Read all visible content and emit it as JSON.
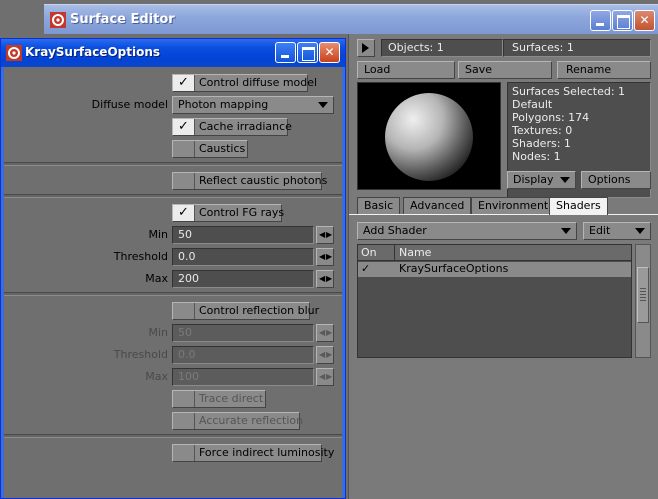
{
  "surface_editor": {
    "title": "Surface Editor",
    "objects_label": "Objects: 1",
    "surfaces_label": "Surfaces: 1",
    "load_label": "Load",
    "save_label": "Save",
    "rename_label": "Rename",
    "info": {
      "surfaces_selected": "Surfaces Selected: 1",
      "default": "Default",
      "polygons": "Polygons: 174",
      "textures": "Textures: 0",
      "shaders": "Shaders: 1",
      "nodes": "Nodes: 1"
    },
    "display_label": "Display",
    "options_label": "Options",
    "tabs": [
      "Basic",
      "Advanced",
      "Environment",
      "Shaders"
    ],
    "active_tab": "Shaders",
    "add_shader_label": "Add Shader",
    "edit_label": "Edit",
    "list_headers": {
      "on": "On",
      "name": "Name"
    },
    "shader_rows": [
      {
        "on": "✓",
        "name": "KraySurfaceOptions"
      }
    ]
  },
  "kray": {
    "title": "KraySurfaceOptions",
    "control_diffuse_model": {
      "label": "Control diffuse model",
      "checked": true
    },
    "diffuse_model_label": "Diffuse model",
    "diffuse_model_value": "Photon mapping",
    "cache_irradiance": {
      "label": "Cache irradiance",
      "checked": true
    },
    "caustics": {
      "label": "Caustics",
      "checked": false
    },
    "reflect_caustic_photons": {
      "label": "Reflect caustic photons",
      "checked": false
    },
    "control_fg_rays": {
      "label": "Control FG rays",
      "checked": true
    },
    "fg": {
      "min_label": "Min",
      "min_value": "50",
      "threshold_label": "Threshold",
      "threshold_value": "0.0",
      "max_label": "Max",
      "max_value": "200"
    },
    "control_reflection_blur": {
      "label": "Control reflection blur",
      "checked": false
    },
    "blur": {
      "min_label": "Min",
      "min_value": "50",
      "threshold_label": "Threshold",
      "threshold_value": "0.0",
      "max_label": "Max",
      "max_value": "100"
    },
    "trace_direct": {
      "label": "Trace direct",
      "checked": false
    },
    "accurate_reflection": {
      "label": "Accurate reflection",
      "checked": false
    },
    "force_indirect_luminosity": {
      "label": "Force indirect luminosity",
      "checked": false
    }
  },
  "colors": {
    "panel": "#6f6f6f",
    "field": "#4e4e4e",
    "xp_title": "#0a4fe0"
  }
}
